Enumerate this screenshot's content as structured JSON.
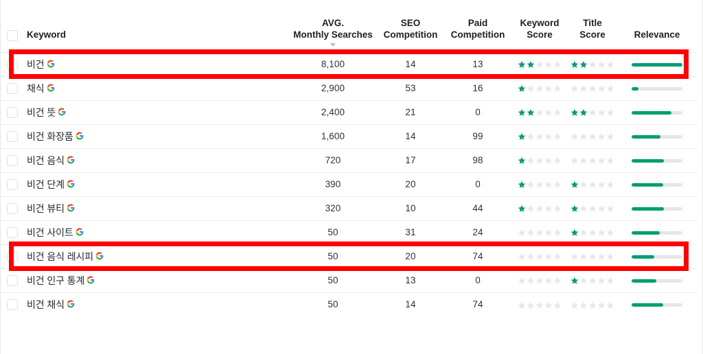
{
  "table": {
    "columns": [
      {
        "key": "select_all",
        "label": "",
        "icon": "checkbox-icon"
      },
      {
        "key": "keyword",
        "label": "Keyword"
      },
      {
        "key": "avg_monthly_searches",
        "label_line1": "AVG.",
        "label_line2": "Monthly Searches",
        "sorted": true,
        "sort_direction": "desc"
      },
      {
        "key": "seo_competition",
        "label_line1": "SEO",
        "label_line2": "Competition"
      },
      {
        "key": "paid_competition",
        "label_line1": "Paid",
        "label_line2": "Competition"
      },
      {
        "key": "keyword_score",
        "label_line1": "Keyword",
        "label_line2": "Score"
      },
      {
        "key": "title_score",
        "label_line1": "Title",
        "label_line2": "Score"
      },
      {
        "key": "relevance",
        "label_line1": "Relevance",
        "label_line2": ""
      }
    ],
    "rows": [
      {
        "keyword": "비건",
        "source_icon": "google-icon",
        "avg_monthly_searches": "8,100",
        "seo_competition": "14",
        "paid_competition": "13",
        "keyword_score": 2,
        "title_score": 2,
        "relevance_percent": 100,
        "highlighted": true
      },
      {
        "keyword": "채식",
        "source_icon": "google-icon",
        "avg_monthly_searches": "2,900",
        "seo_competition": "53",
        "paid_competition": "16",
        "keyword_score": 1,
        "title_score": 0,
        "relevance_percent": 14,
        "highlighted": false
      },
      {
        "keyword": "비건 뜻",
        "source_icon": "google-icon",
        "avg_monthly_searches": "2,400",
        "seo_competition": "21",
        "paid_competition": "0",
        "keyword_score": 2,
        "title_score": 2,
        "relevance_percent": 78,
        "highlighted": false
      },
      {
        "keyword": "비건 화장품",
        "source_icon": "google-icon",
        "avg_monthly_searches": "1,600",
        "seo_competition": "14",
        "paid_competition": "99",
        "keyword_score": 1,
        "title_score": 0,
        "relevance_percent": 57,
        "highlighted": false
      },
      {
        "keyword": "비건 음식",
        "source_icon": "google-icon",
        "avg_monthly_searches": "720",
        "seo_competition": "17",
        "paid_competition": "98",
        "keyword_score": 1,
        "title_score": 0,
        "relevance_percent": 64,
        "highlighted": false
      },
      {
        "keyword": "비건 단계",
        "source_icon": "google-icon",
        "avg_monthly_searches": "390",
        "seo_competition": "20",
        "paid_competition": "0",
        "keyword_score": 1,
        "title_score": 1,
        "relevance_percent": 62,
        "highlighted": false
      },
      {
        "keyword": "비건 뷰티",
        "source_icon": "google-icon",
        "avg_monthly_searches": "320",
        "seo_competition": "10",
        "paid_competition": "44",
        "keyword_score": 1,
        "title_score": 1,
        "relevance_percent": 63,
        "highlighted": false
      },
      {
        "keyword": "비건 사이트",
        "source_icon": "google-icon",
        "avg_monthly_searches": "50",
        "seo_competition": "31",
        "paid_competition": "24",
        "keyword_score": 0,
        "title_score": 1,
        "relevance_percent": 55,
        "highlighted": false
      },
      {
        "keyword": "비건 음식 레시피",
        "source_icon": "google-icon",
        "avg_monthly_searches": "50",
        "seo_competition": "20",
        "paid_competition": "74",
        "keyword_score": 0,
        "title_score": 0,
        "relevance_percent": 44,
        "highlighted": true
      },
      {
        "keyword": "비건 인구 통계",
        "source_icon": "google-icon",
        "avg_monthly_searches": "50",
        "seo_competition": "13",
        "paid_competition": "0",
        "keyword_score": 0,
        "title_score": 1,
        "relevance_percent": 48,
        "highlighted": false
      },
      {
        "keyword": "비건 채식",
        "source_icon": "google-icon",
        "avg_monthly_searches": "50",
        "seo_competition": "14",
        "paid_competition": "74",
        "keyword_score": 0,
        "title_score": 0,
        "relevance_percent": 62,
        "highlighted": false
      }
    ]
  },
  "colors": {
    "star_filled": "#009e74",
    "star_empty": "#e8e8e8",
    "relevance_fill": "#009e74",
    "relevance_track": "#e6e6e6",
    "annotation": "#ff0000",
    "row_border": "#ededed"
  },
  "annotations": [
    {
      "name": "highlight-box-row-1",
      "target_row": 0
    },
    {
      "name": "highlight-box-row-9",
      "target_row": 8
    }
  ]
}
